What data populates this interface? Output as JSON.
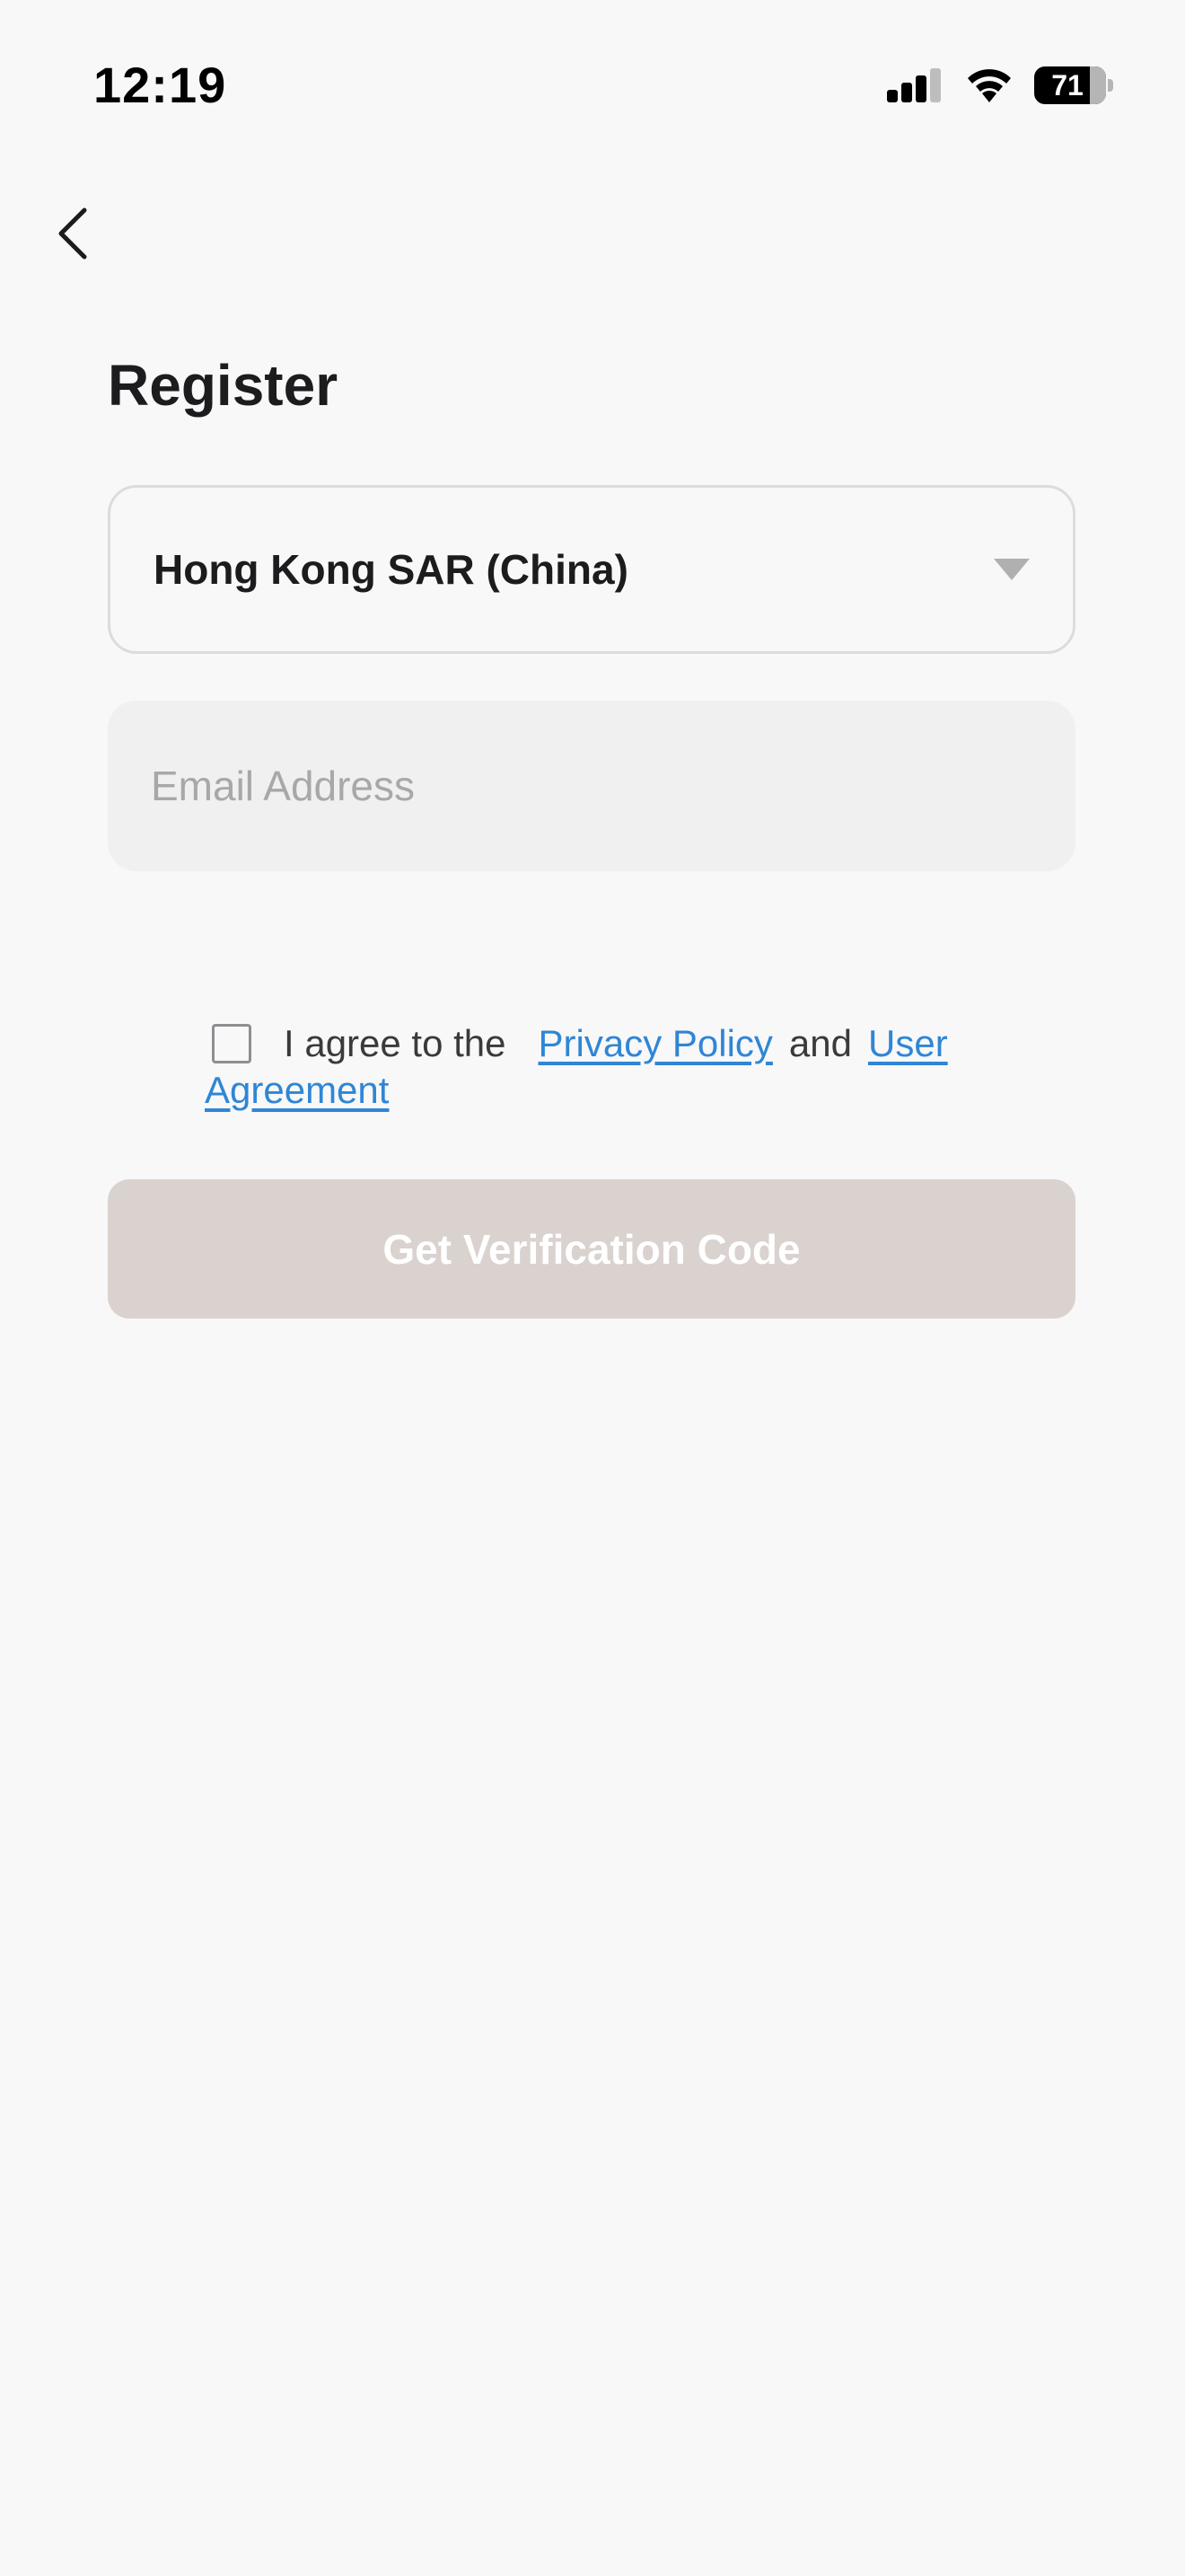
{
  "status_bar": {
    "time": "12:19",
    "battery": "71",
    "icons": [
      "signal-icon",
      "wifi-icon",
      "battery-icon"
    ]
  },
  "nav": {
    "back_icon": "chevron-left-icon"
  },
  "page": {
    "title": "Register"
  },
  "form": {
    "country_value": "Hong Kong SAR (China)",
    "email_placeholder": "Email Address",
    "agree_prefix": "I agree to the",
    "privacy_link": "Privacy Policy",
    "and_text": "and",
    "agreement_link": "User Agreement",
    "submit_label": "Get Verification Code"
  },
  "colors": {
    "background": "#f8f8f8",
    "link": "#2f86d6",
    "button_disabled": "#d9d2ce",
    "input_fill": "#f0f0f0"
  }
}
